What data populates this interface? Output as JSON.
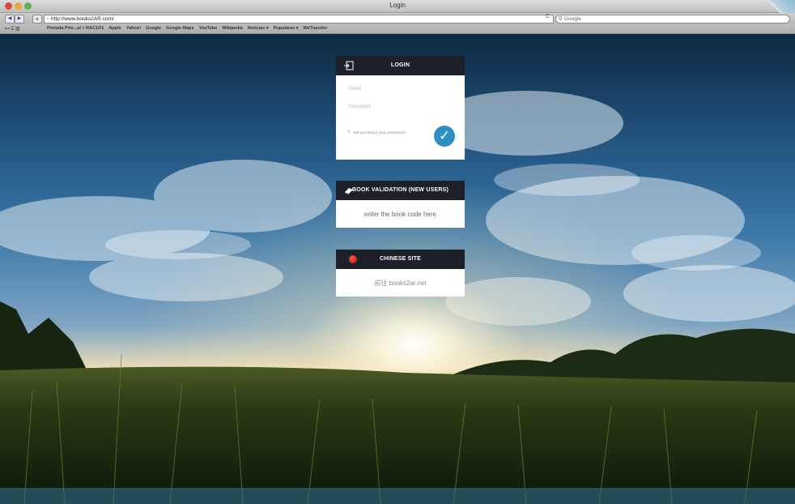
{
  "browser": {
    "window_title": "Login",
    "nav": {
      "back": "◀",
      "forward": "▶",
      "add": "+"
    },
    "url": "http://www.books2AR.com/",
    "reload_label": "C",
    "search_placeholder": "Google",
    "bookmark_icons": "⊷ ⌸ ▥",
    "bookmarks": [
      "Portada Prin...al > RAC1O1",
      "Apple",
      "Yahoo!",
      "Google",
      "Google Maps",
      "YouTube",
      "Wikipedia",
      "Noticias ▾",
      "Populares ▾",
      "WeTransfer"
    ]
  },
  "login": {
    "header": "LOGIN",
    "email_placeholder": "Email",
    "password_placeholder": "Password",
    "forgot_mark": "?",
    "forgot_text": "Did you forgot your password?",
    "submit_icon": "✓"
  },
  "book_validation": {
    "header": "BOOK VALIDATION (NEW USERS)",
    "input_placeholder": "enter the book code here"
  },
  "chinese_site": {
    "header": "CHINESE SITE",
    "link_text": "前往 books2ar.net"
  },
  "colors": {
    "card_header": "#1d1f29",
    "accent": "#2e8fc6",
    "flag_red": "#d81e1e"
  }
}
